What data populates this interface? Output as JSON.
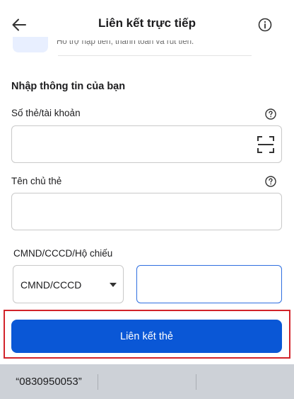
{
  "header": {
    "title": "Liên kết trực tiếp",
    "back_icon": "arrow-left-icon",
    "info_icon": "info-circle-icon"
  },
  "top_card": {
    "text": "Hỗ trợ nạp tiền, thanh toán và rút tiền."
  },
  "form": {
    "section_title": "Nhập thông tin của bạn",
    "card_number": {
      "label": "Số thẻ/tài khoản",
      "value": "",
      "help_icon": "help-circle-icon",
      "scan_icon": "scan-frame-icon"
    },
    "cardholder": {
      "label": "Tên chủ thẻ",
      "value": "",
      "help_icon": "help-circle-icon"
    },
    "id_document": {
      "label": "CMND/CCCD/Hộ chiếu",
      "type_selected": "CMND/CCCD",
      "value": ""
    }
  },
  "submit_label": "Liên kết thẻ",
  "keyboard": {
    "suggestion": "“0830950053”"
  },
  "colors": {
    "primary": "#0a57d6",
    "focus_border": "#2f6fe0",
    "highlight": "#d2232a",
    "keyboard_bg": "#cdd1d7"
  }
}
